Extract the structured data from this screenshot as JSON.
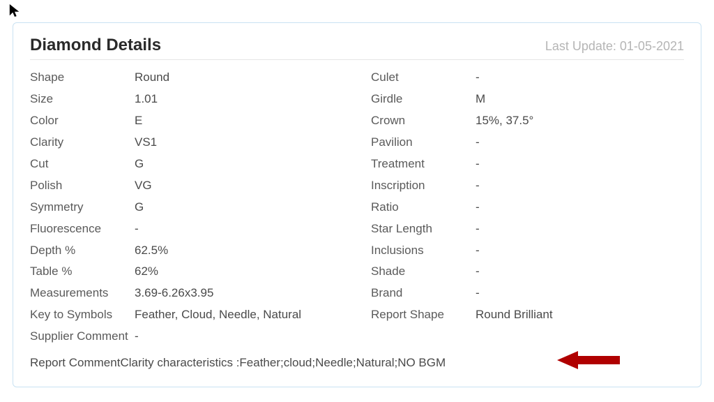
{
  "header": {
    "title": "Diamond Details",
    "last_update_label": "Last Update: 01-05-2021"
  },
  "left_fields": [
    {
      "label": "Shape",
      "value": "Round"
    },
    {
      "label": "Size",
      "value": "1.01"
    },
    {
      "label": "Color",
      "value": "E"
    },
    {
      "label": "Clarity",
      "value": "VS1"
    },
    {
      "label": "Cut",
      "value": "G"
    },
    {
      "label": "Polish",
      "value": "VG"
    },
    {
      "label": "Symmetry",
      "value": "G"
    },
    {
      "label": "Fluorescence",
      "value": "-"
    },
    {
      "label": "Depth %",
      "value": "62.5%"
    },
    {
      "label": "Table %",
      "value": "62%"
    },
    {
      "label": "Measurements",
      "value": "3.69-6.26x3.95"
    },
    {
      "label": "Key to Symbols",
      "value": "Feather, Cloud, Needle, Natural"
    },
    {
      "label": "Supplier Comment",
      "value": "-"
    }
  ],
  "right_fields": [
    {
      "label": "Culet",
      "value": "-"
    },
    {
      "label": "Girdle",
      "value": "M"
    },
    {
      "label": "Crown",
      "value": "15%, 37.5°"
    },
    {
      "label": "Pavilion",
      "value": "-"
    },
    {
      "label": "Treatment",
      "value": "-"
    },
    {
      "label": "Inscription",
      "value": "-"
    },
    {
      "label": "Ratio",
      "value": "-"
    },
    {
      "label": "Star Length",
      "value": "-"
    },
    {
      "label": "Inclusions",
      "value": "-"
    },
    {
      "label": "Shade",
      "value": "-"
    },
    {
      "label": "Brand",
      "value": "-"
    },
    {
      "label": "Report Shape",
      "value": "Round Brilliant"
    }
  ],
  "report_comment": {
    "label": "Report Comment",
    "value": "Clarity characteristics :Feather;cloud;Needle;Natural;NO BGM"
  },
  "annotation": {
    "arrow_color": "#b00000"
  }
}
